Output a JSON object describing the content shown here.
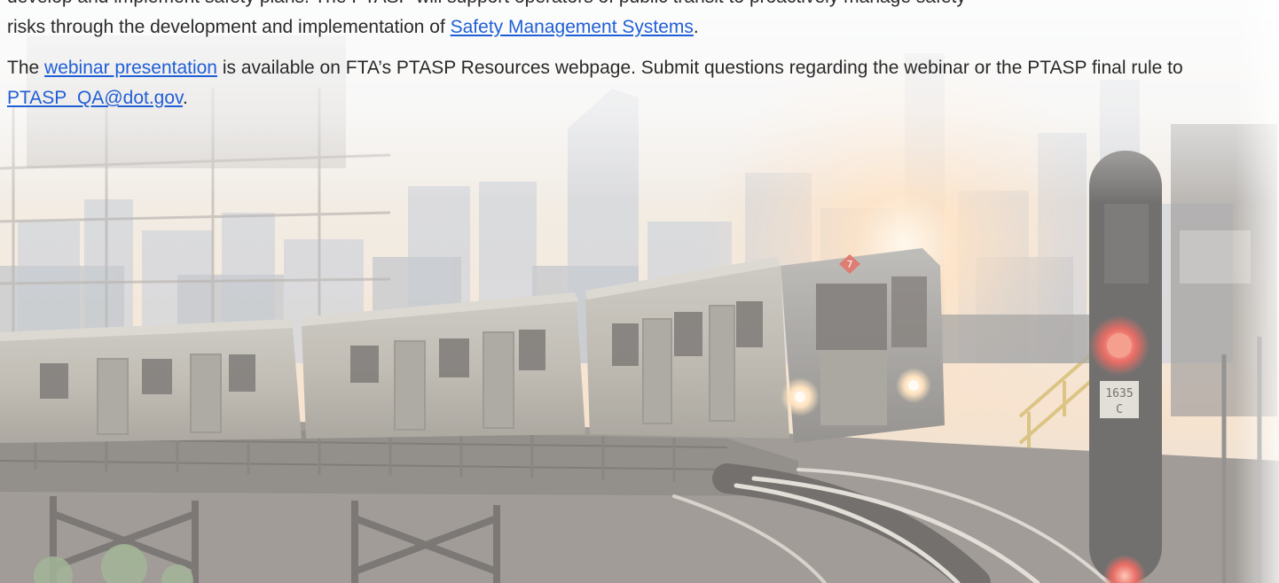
{
  "content": {
    "para1_line1": "develop and implement safety plans. The PTASP will support operators of public transit to proactively manage safety",
    "para1_prefix": "risks through the development and implementation of ",
    "para1_link": "Safety Management Systems",
    "para1_suffix": ".",
    "para2_prefix": "The ",
    "para2_link": "webinar presentation",
    "para2_middle": " is available on FTA’s PTASP Resources webpage. Submit questions regarding the webinar or the PTASP final rule to ",
    "para2_email": "PTASP_QA@dot.gov",
    "para2_suffix": "."
  },
  "photo": {
    "signal_plate_line1": "1635",
    "signal_plate_line2": "C",
    "route_symbol": "7"
  },
  "colors": {
    "link": "#1f5fd6",
    "text": "#2a2a2a",
    "sky_warm": "#f6dfc4",
    "signal_red": "#e0352a"
  }
}
